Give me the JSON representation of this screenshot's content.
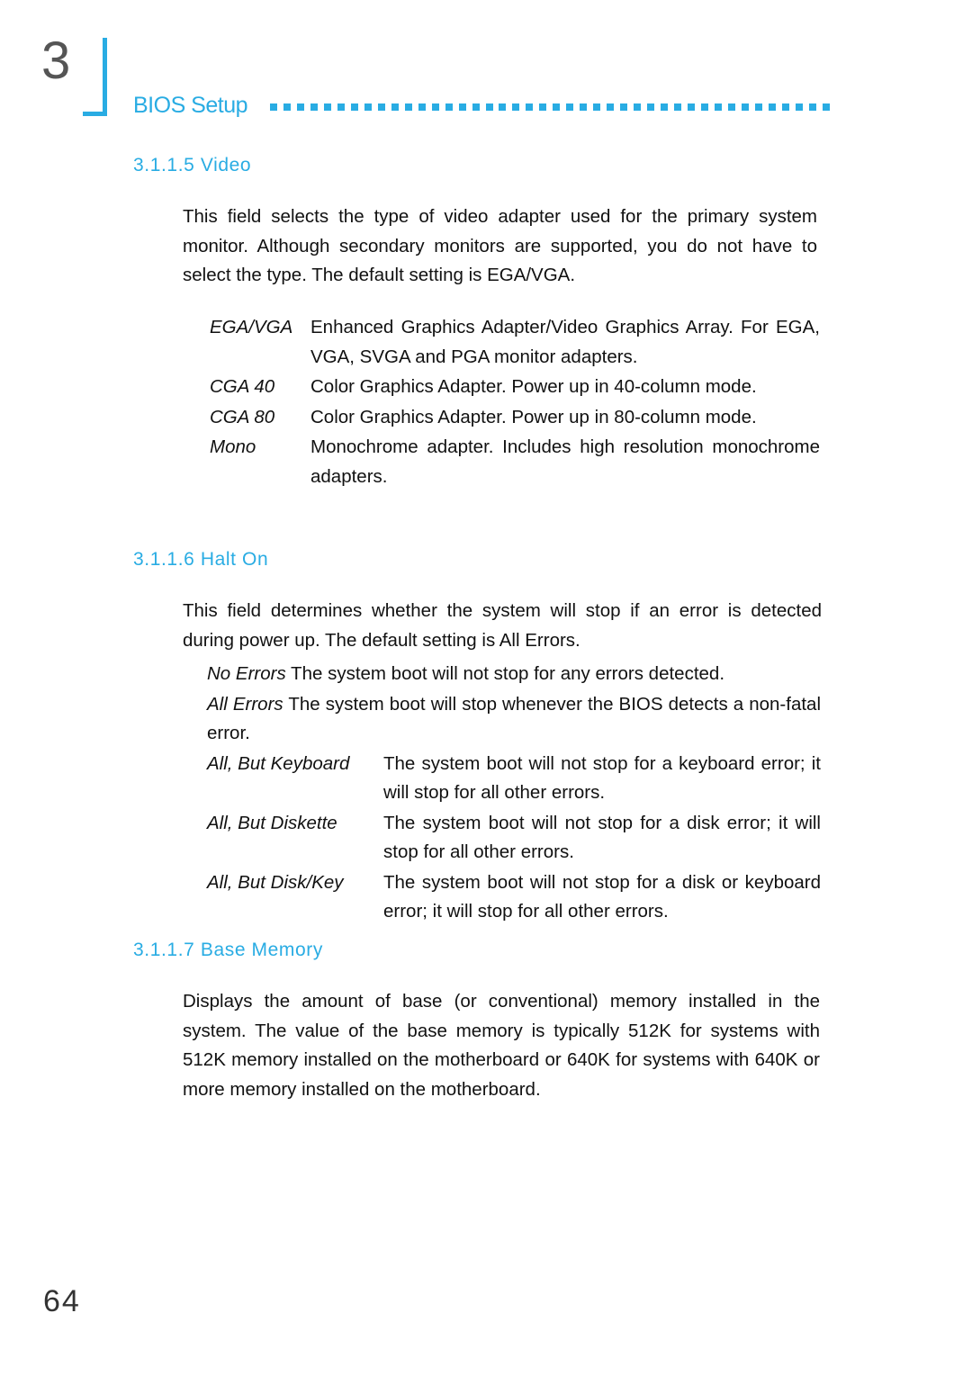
{
  "header": {
    "chapter_number": "3",
    "title": "BIOS Setup",
    "dot_count": 42
  },
  "sections": [
    {
      "id": "video",
      "number": "3.1.1.5",
      "heading": "3.1.1.5  Video",
      "body": "This field selects the type of video adapter used for the primary system monitor. Although secondary monitors are supported, you do not have to select the type. The default setting is EGA/VGA.",
      "definitions": [
        {
          "term": "EGA/VGA",
          "desc": "Enhanced Graphics Adapter/Video Graphics Array. For EGA, VGA, SVGA and PGA monitor adapters."
        },
        {
          "term": "CGA 40",
          "desc": "Color Graphics Adapter. Power up in 40-column mode."
        },
        {
          "term": "CGA 80",
          "desc": "Color Graphics Adapter. Power up in 80-column mode."
        },
        {
          "term": "Mono",
          "desc": "Monochrome adapter. Includes high resolution monochrome adapters."
        }
      ]
    },
    {
      "id": "halt-on",
      "number": "3.1.1.6",
      "heading": "3.1.1.6  Halt On",
      "body": "This field determines whether the system will stop if an error is detected during power up. The default setting is All Errors.",
      "definitions": [
        {
          "term": "No Errors",
          "desc": "The system boot will not stop for any errors detected."
        },
        {
          "term": "All Errors",
          "desc": "The system boot will stop whenever the BIOS detects a non-fatal error."
        },
        {
          "term": "All, But Keyboard",
          "desc": "The system boot will not stop for a keyboard error; it will stop for all other errors."
        },
        {
          "term": "All, But Diskette",
          "desc": "The system boot will not stop for a disk error; it will stop for all other errors."
        },
        {
          "term": "All, But Disk/Key",
          "desc": "The system boot will not stop for a disk or keyboard error; it will stop for all other errors."
        }
      ]
    },
    {
      "id": "base-memory",
      "number": "3.1.1.7",
      "heading": "3.1.1.7  Base Memory",
      "body": "Displays the amount of base (or conventional) memory installed in the system. The value of the base memory is typically 512K for systems with 512K memory installed on the motherboard or 640K for systems with 640K or more memory installed on the motherboard.",
      "definitions": []
    }
  ],
  "footer": {
    "page_number": "64"
  },
  "colors": {
    "accent": "#29ace3",
    "text": "#111111",
    "chapter_number": "#555555"
  }
}
